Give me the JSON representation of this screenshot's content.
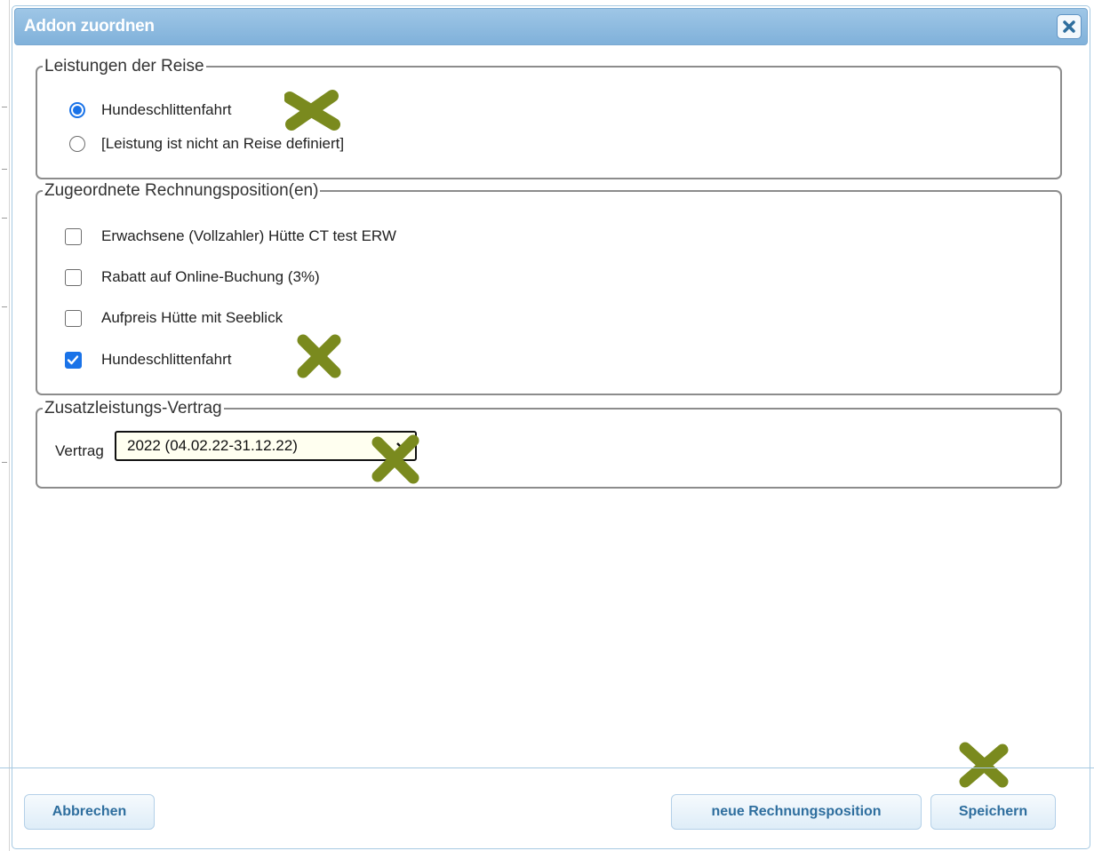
{
  "dialog": {
    "title": "Addon zuordnen"
  },
  "leistungen": {
    "legend": "Leistungen der Reise",
    "options": [
      {
        "label": "Hundeschlittenfahrt",
        "selected": true
      },
      {
        "label": "[Leistung ist nicht an Reise definiert]",
        "selected": false
      }
    ]
  },
  "rechnung": {
    "legend": "Zugeordnete Rechnungsposition(en)",
    "items": [
      {
        "label": "Erwachsene (Vollzahler) Hütte CT test ERW",
        "checked": false
      },
      {
        "label": "Rabatt auf Online-Buchung (3%)",
        "checked": false
      },
      {
        "label": "Aufpreis Hütte mit Seeblick",
        "checked": false
      },
      {
        "label": "Hundeschlittenfahrt",
        "checked": true
      }
    ]
  },
  "vertrag": {
    "legend": "Zusatzleistungs-Vertrag",
    "label": "Vertrag",
    "selected": "2022 (04.02.22-31.12.22)"
  },
  "footer": {
    "cancel": "Abbrechen",
    "new_position": "neue Rechnungsposition",
    "save": "Speichern"
  },
  "colors": {
    "accent": "#1a73e8",
    "title_bar": "#80b1da",
    "button_text": "#2e6e9e",
    "annotation_mark": "#7a8a1e"
  },
  "icons": [
    "close-icon",
    "checkmark-icon",
    "dropdown-arrow-icon",
    "annotation-cross-icon"
  ]
}
